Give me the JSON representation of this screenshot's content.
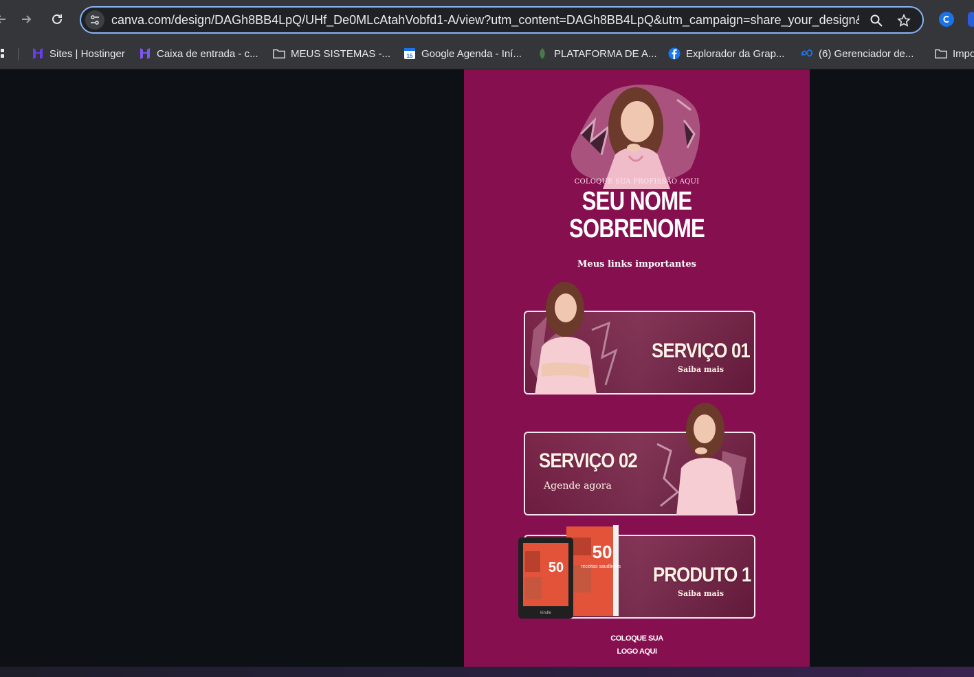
{
  "browser": {
    "url": "canva.com/design/DAGh8BB4LpQ/UHf_De0MLcAtahVobfd1-A/view?utm_content=DAGh8BB4LpQ&utm_campaign=share_your_design&ut...",
    "bookmarks": [
      {
        "label": "Sites | Hostinger",
        "icon": "hostinger-icon",
        "color": "#673de6"
      },
      {
        "label": "Caixa de entrada - c...",
        "icon": "hostinger-mail-icon",
        "color": "#673de6"
      },
      {
        "label": "MEUS SISTEMAS -...",
        "icon": "folder-icon",
        "color": "#e8eaed"
      },
      {
        "label": "Google Agenda - Iní...",
        "icon": "google-calendar-icon",
        "color": "#1a73e8"
      },
      {
        "label": "PLATAFORMA DE A...",
        "icon": "leaf-icon",
        "color": "#3c6e3c"
      },
      {
        "label": "Explorador da Grap...",
        "icon": "facebook-icon",
        "color": "#1877f2"
      },
      {
        "label": "(6) Gerenciador de...",
        "icon": "meta-icon",
        "color": "#1877f2"
      },
      {
        "label": "Impo",
        "icon": "folder-icon",
        "color": "#e8eaed"
      }
    ]
  },
  "design": {
    "background": "#860f4f",
    "profession": "COLOQUE SUA PROFISSÃO AQUI",
    "name_line1": "SEU NOME",
    "name_line2": "SOBRENOME",
    "links_title": "Meus links importantes",
    "cards": [
      {
        "title": "SERVIÇO 01",
        "subtitle": "Saiba mais"
      },
      {
        "title": "SERVIÇO 02",
        "subtitle": "Agende agora"
      },
      {
        "title": "PRODUTO 1",
        "subtitle": "Saiba mais"
      }
    ],
    "book_number": "50",
    "book_text": "receitas saudáveis",
    "kindle_label": "kindle",
    "logo_line1": "COLOQUE SUA",
    "logo_line2": "LOGO AQUI"
  }
}
